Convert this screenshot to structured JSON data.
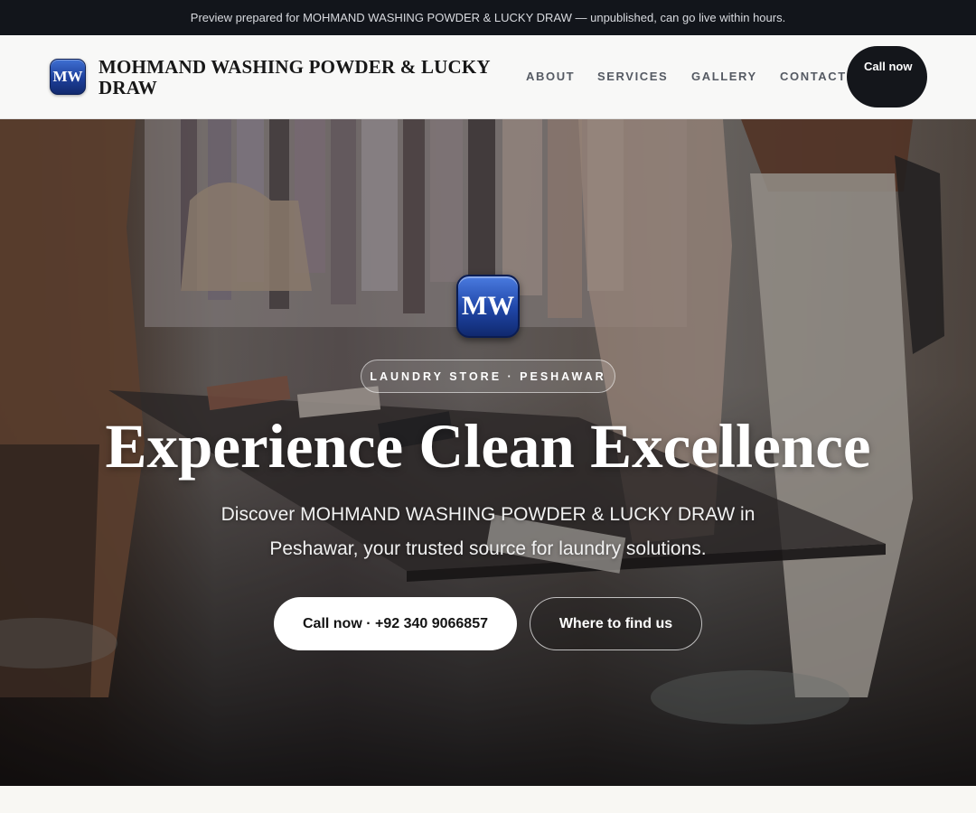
{
  "preview_banner": {
    "text": "Preview prepared for MOHMAND WASHING POWDER & LUCKY DRAW — unpublished, can go live within hours."
  },
  "header": {
    "logo_initials": "MW",
    "brand_name": "MOHMAND WASHING POWDER & LUCKY DRAW",
    "nav": [
      {
        "label": "ABOUT"
      },
      {
        "label": "SERVICES"
      },
      {
        "label": "GALLERY"
      },
      {
        "label": "CONTACT"
      }
    ],
    "call_button": "Call now"
  },
  "hero": {
    "logo_initials": "MW",
    "tag": "LAUNDRY STORE · PESHAWAR",
    "title": "Experience Clean Excellence",
    "subtitle": "Discover MOHMAND WASHING POWDER & LUCKY DRAW in Peshawar, your trusted source for laundry solutions.",
    "primary_button": "Call now · +92 340 9066857",
    "secondary_button": "Where to find us"
  },
  "colors": {
    "banner_bg": "#12151b",
    "header_bg": "#f8f8f7",
    "call_button_bg": "#14161b",
    "logo_blue": "#1f45a6"
  }
}
